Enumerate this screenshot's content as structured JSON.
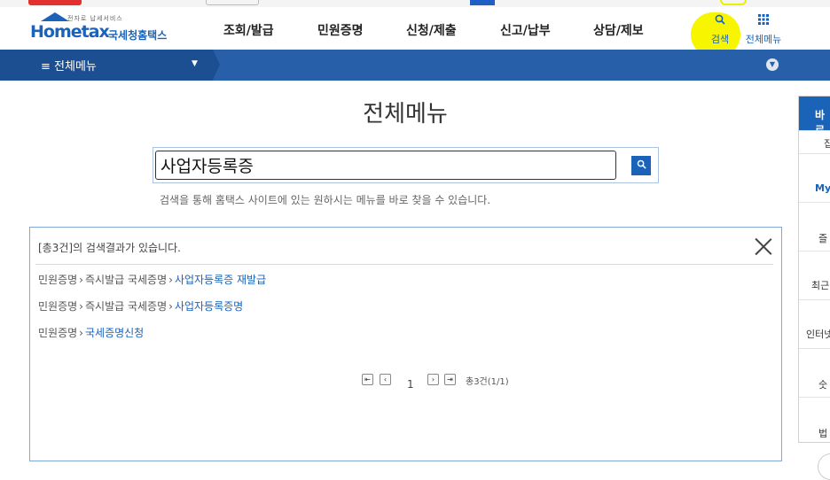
{
  "header": {
    "logo_text_main": "Hometax",
    "logo_text_korean": "국세청홈택스",
    "logo_tagline": "전자로 납세서비스",
    "nav": [
      "조회/발급",
      "민원증명",
      "신청/제출",
      "신고/납부",
      "상담/제보"
    ],
    "search_label": "검색",
    "allmenu_label": "전체메뉴",
    "search_icon": "search-icon",
    "allmenu_icon": "grid-icon"
  },
  "navbar": {
    "menu_label": "≡  전체메뉴"
  },
  "page": {
    "title": "전체메뉴"
  },
  "search": {
    "value": "사업자등록증",
    "help": "검색을 통해 홈택스 사이트에 있는 원하시는 메뉴를 바로 찾을 수 있습니다."
  },
  "results": {
    "summary": "[총3건]의 검색결과가 있습니다.",
    "rows": [
      {
        "path1": "민원증명",
        "path2": "즉시발급 국세증명",
        "target": "사업자등록증 재발급"
      },
      {
        "path1": "민원증명",
        "path2": "즉시발급 국세증명",
        "target": "사업자등록증명"
      },
      {
        "path1": "민원증명",
        "path2": "",
        "target": "국세증명신청"
      }
    ],
    "pager": {
      "current": "1",
      "total": "총3건(1/1)"
    }
  },
  "quick_panel": {
    "head": "바로",
    "items": [
      "집",
      "My",
      "즐",
      "최근",
      "인터넷",
      "숫",
      "법"
    ]
  },
  "colors": {
    "brand_blue": "#1a63b8",
    "bar_blue": "#2760a9",
    "highlight_yellow": "#f7f500"
  }
}
